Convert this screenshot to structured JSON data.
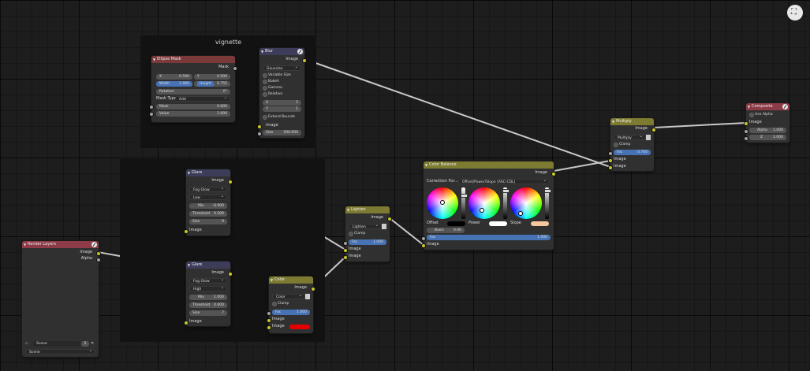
{
  "frames": {
    "vignette_label": "vignette"
  },
  "nodes": {
    "ellipse_mask": {
      "title": "Ellipse Mask",
      "output": "Mask",
      "x_label": "X",
      "x_value": "0.500",
      "y_label": "Y",
      "y_value": "0.500",
      "width_label": "Width",
      "width_value": "1.060",
      "height_label": "Height",
      "height_value": "0.755",
      "rotation_label": "Rotation",
      "rotation_value": "0°",
      "mask_type_label": "Mask Type",
      "mask_type_value": "Add",
      "mask_label": "Mask",
      "mask_value": "0.000",
      "value_label": "Value",
      "value_value": "1.000"
    },
    "blur": {
      "title": "Blur",
      "output": "Image",
      "filter_type": "Gaussian",
      "variable_size": "Variable Size",
      "bokeh": "Bokeh",
      "gamma": "Gamma",
      "relative": "Relative",
      "x_label": "X",
      "x_value": "2",
      "y_label": "Y",
      "y_value": "1",
      "extend_bounds": "Extend Bounds",
      "input_image": "Image",
      "size_label": "Size",
      "size_value": "500.000"
    },
    "glare1": {
      "title": "Glare",
      "output": "Image",
      "glare_type": "Fog Glow",
      "quality": "Low",
      "mix_label": "Mix",
      "mix_value": "-0.900",
      "threshold_label": "Threshold",
      "threshold_value": "0.500",
      "size_label": "Size",
      "size_value": "9",
      "input_image": "Image"
    },
    "glare2": {
      "title": "Glare",
      "output": "Image",
      "glare_type": "Fog Glow",
      "quality": "High",
      "mix_label": "Mix",
      "mix_value": "1.000",
      "threshold_label": "Threshold",
      "threshold_value": "0.600",
      "size_label": "Size",
      "size_value": "7",
      "input_image": "Image"
    },
    "render_layers": {
      "title": "Render Layers",
      "out_image": "Image",
      "out_alpha": "Alpha",
      "scene_field": "Scene",
      "scene_users": "2",
      "scene_select": "Scene"
    },
    "color_mix": {
      "title": "Color",
      "output": "Image",
      "blend_type": "Color",
      "clamp": "Clamp",
      "fac_label": "Fac",
      "fac_value": "1.000",
      "input_image1": "Image",
      "input_image2": "Image",
      "swatch_color": "#e50000"
    },
    "lighten": {
      "title": "Lighten",
      "output": "Image",
      "blend_type": "Lighten",
      "clamp": "Clamp",
      "fac_label": "Fac",
      "fac_value": "1.000",
      "input_image1": "Image",
      "input_image2": "Image"
    },
    "color_balance": {
      "title": "Color Balance",
      "output": "Image",
      "correction_label": "Correction For...",
      "correction_value": "Offset/Power/Slope (ASC-CDL)",
      "offset_label": "Offset",
      "power_label": "Power",
      "slope_label": "Slope",
      "offset_color": "#000000",
      "power_color": "#ffffff",
      "slope_color": "#f7c69c",
      "basis_label": "Basis",
      "basis_value": "0.00",
      "fac_label": "Fac",
      "fac_value": "1.000",
      "input_image": "Image"
    },
    "multiply": {
      "title": "Multiply",
      "output": "Image",
      "blend_type": "Multiply",
      "clamp": "Clamp",
      "fac_label": "Fac",
      "fac_value": "0.700",
      "input_image1": "Image",
      "input_image2": "Image"
    },
    "composite": {
      "title": "Composite",
      "use_alpha": "Use Alpha",
      "input_image": "Image",
      "alpha_label": "Alpha",
      "alpha_value": "1.000",
      "z_label": "Z",
      "z_value": "1.000"
    }
  },
  "colors": {
    "filter_header": "#3d3d5a",
    "color_header": "#7d7b31",
    "input_header": "#8c3b47",
    "socket_color": "#c7c729",
    "socket_value": "#a1a1a1",
    "socket_vector": "#6363c7",
    "link": "#c8c8c8"
  },
  "icons": {
    "navigate": "fullscreen-toggle-icon"
  }
}
